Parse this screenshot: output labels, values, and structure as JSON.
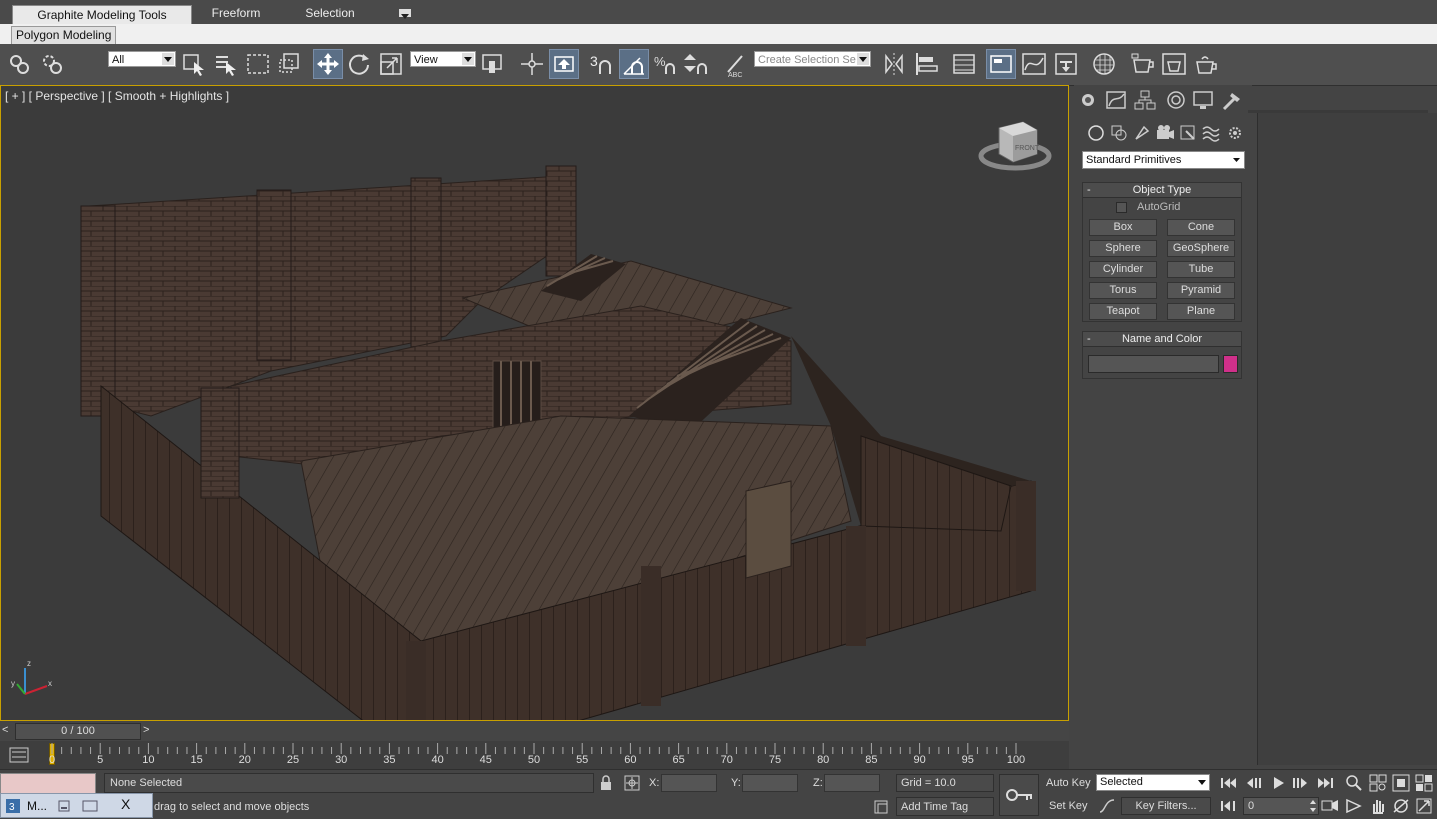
{
  "ribbon": {
    "tabs": [
      "Graphite Modeling Tools",
      "Freeform",
      "Selection"
    ],
    "subtab": "Polygon Modeling"
  },
  "toolbar": {
    "selection_filter": "All",
    "ref_coord": "View",
    "named_selection_placeholder": "Create Selection Se",
    "snaps_label": "3"
  },
  "viewport": {
    "label": "[ + ] [ Perspective ] [ Smooth + Highlights ]",
    "viewcube_face": "FRONT",
    "axis_labels": {
      "z": "z",
      "x": "x",
      "y": "y"
    }
  },
  "command_panel": {
    "category_dropdown": "Standard Primitives",
    "object_type": {
      "title": "Object Type",
      "autogrid": "AutoGrid",
      "buttons": [
        "Box",
        "Cone",
        "Sphere",
        "GeoSphere",
        "Cylinder",
        "Tube",
        "Torus",
        "Pyramid",
        "Teapot",
        "Plane"
      ]
    },
    "name_color": {
      "title": "Name and Color",
      "swatch": "#d0308a"
    }
  },
  "timeline": {
    "frame_display": "0 / 100",
    "prev": "<",
    "next": ">",
    "ticks": [
      "0",
      "5",
      "10",
      "15",
      "20",
      "25",
      "30",
      "35",
      "40",
      "45",
      "50",
      "55",
      "60",
      "65",
      "70",
      "75",
      "80",
      "85",
      "90",
      "95",
      "100"
    ]
  },
  "status": {
    "selection": "None Selected",
    "prompt": "drag to select and move objects",
    "x_label": "X:",
    "y_label": "Y:",
    "z_label": "Z:",
    "grid": "Grid = 10.0",
    "add_time_tag": "Add Time Tag",
    "auto_key": "Auto Key",
    "set_key": "Set Key",
    "key_mode": "Selected",
    "key_filters": "Key Filters...",
    "current_frame": "0"
  },
  "taskbar": {
    "app_label": "M...",
    "close": "X"
  }
}
